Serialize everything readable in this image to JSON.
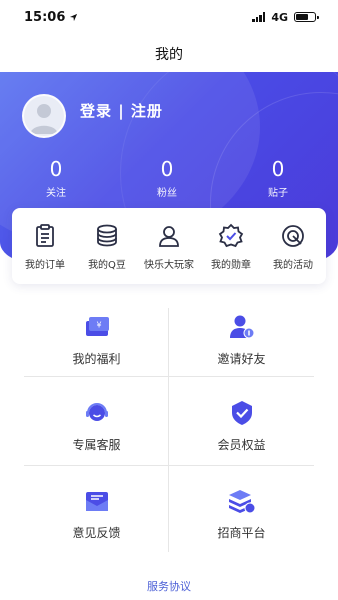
{
  "status_bar": {
    "time": "15:06",
    "network": "4G"
  },
  "nav": {
    "title": "我的"
  },
  "profile": {
    "login_text": "登录 | 注册"
  },
  "stats": [
    {
      "value": "0",
      "label": "关注"
    },
    {
      "value": "0",
      "label": "粉丝"
    },
    {
      "value": "0",
      "label": "贴子"
    }
  ],
  "quick_actions": [
    {
      "label": "我的订单",
      "icon": "clipboard-icon"
    },
    {
      "label": "我的Q豆",
      "icon": "coin-stack-icon"
    },
    {
      "label": "快乐大玩家",
      "icon": "user-icon"
    },
    {
      "label": "我的勋章",
      "icon": "badge-check-icon"
    },
    {
      "label": "我的活动",
      "icon": "target-icon"
    }
  ],
  "services": [
    {
      "label": "我的福利",
      "icon": "welfare-ticket-icon"
    },
    {
      "label": "邀请好友",
      "icon": "invite-friend-icon"
    },
    {
      "label": "专属客服",
      "icon": "customer-service-icon"
    },
    {
      "label": "会员权益",
      "icon": "member-shield-icon"
    },
    {
      "label": "意见反馈",
      "icon": "feedback-mail-icon"
    },
    {
      "label": "招商平台",
      "icon": "business-layers-icon"
    }
  ],
  "footer": {
    "agreement": "服务协议"
  },
  "colors": {
    "primary": "#4b4de6",
    "accent": "#4b5fd6"
  }
}
